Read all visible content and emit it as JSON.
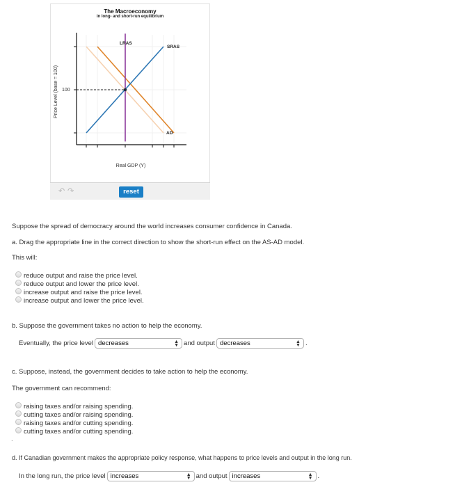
{
  "graph": {
    "title": "The Macroeconomy",
    "subtitle": "in long- and short-run equilibrium",
    "undo_icon": "undo-icon",
    "redo_icon": "redo-icon",
    "reset_label": "reset"
  },
  "chart_data": {
    "type": "line",
    "title": "The Macroeconomy",
    "subtitle": "in long- and short-run equilibrium",
    "xlabel": "Real GDP (Y)",
    "ylabel": "Price Level (base = 100)",
    "y_tick_labels": [
      "100"
    ],
    "grid": true,
    "equilibrium": {
      "x_index": 2,
      "price_level": 100
    },
    "x_ticks": [
      1,
      2,
      3,
      4,
      5,
      6
    ],
    "y_ticks": [
      1,
      2,
      3
    ],
    "series": [
      {
        "name": "LRAS",
        "color": "#8e3a9d",
        "points": [
          [
            3,
            0.8
          ],
          [
            3,
            3.3
          ]
        ]
      },
      {
        "name": "SRAS",
        "color": "#2f78b5",
        "points": [
          [
            1,
            1
          ],
          [
            5,
            3
          ]
        ]
      },
      {
        "name": "AD",
        "color": "#e0862c",
        "points": [
          [
            2,
            3
          ],
          [
            6,
            1
          ]
        ]
      },
      {
        "name": "AD (original, faded)",
        "color": "#f6d2b2",
        "points": [
          [
            1,
            3
          ],
          [
            5,
            1
          ]
        ]
      }
    ]
  },
  "question": {
    "intro": "Suppose the spread of democracy around the world increases consumer confidence in Canada.",
    "part_a": {
      "prompt": "a. Drag the appropriate line in the correct direction to show the short-run effect on the AS-AD model.",
      "lead": "This will:",
      "options": [
        "reduce output and raise the price level.",
        "reduce output and lower the price level.",
        "increase output and raise the price level.",
        "increase output and lower the price level."
      ]
    },
    "part_b": {
      "prompt": "b. Suppose the government takes no action to help the economy.",
      "lead": "Eventually, the price level",
      "mid": "and output",
      "end": ".",
      "price_select": "decreases",
      "output_select": "decreases"
    },
    "part_c": {
      "prompt": "c. Suppose, instead, the government decides to take action to help the economy.",
      "lead": "The government can recommend:",
      "options": [
        "raising taxes and/or raising spending.",
        "cutting taxes and/or raising spending.",
        "raising taxes and/or cutting spending.",
        "cutting taxes and/or cutting spending."
      ],
      "trailing_mark": "."
    },
    "part_d": {
      "prompt": "d. If Canadian government makes the appropriate policy response, what happens to price levels and output in the long run.",
      "lead": "In the long run, the price level",
      "mid": "and output",
      "end": ".",
      "price_select": "increases",
      "output_select": "increases"
    }
  }
}
